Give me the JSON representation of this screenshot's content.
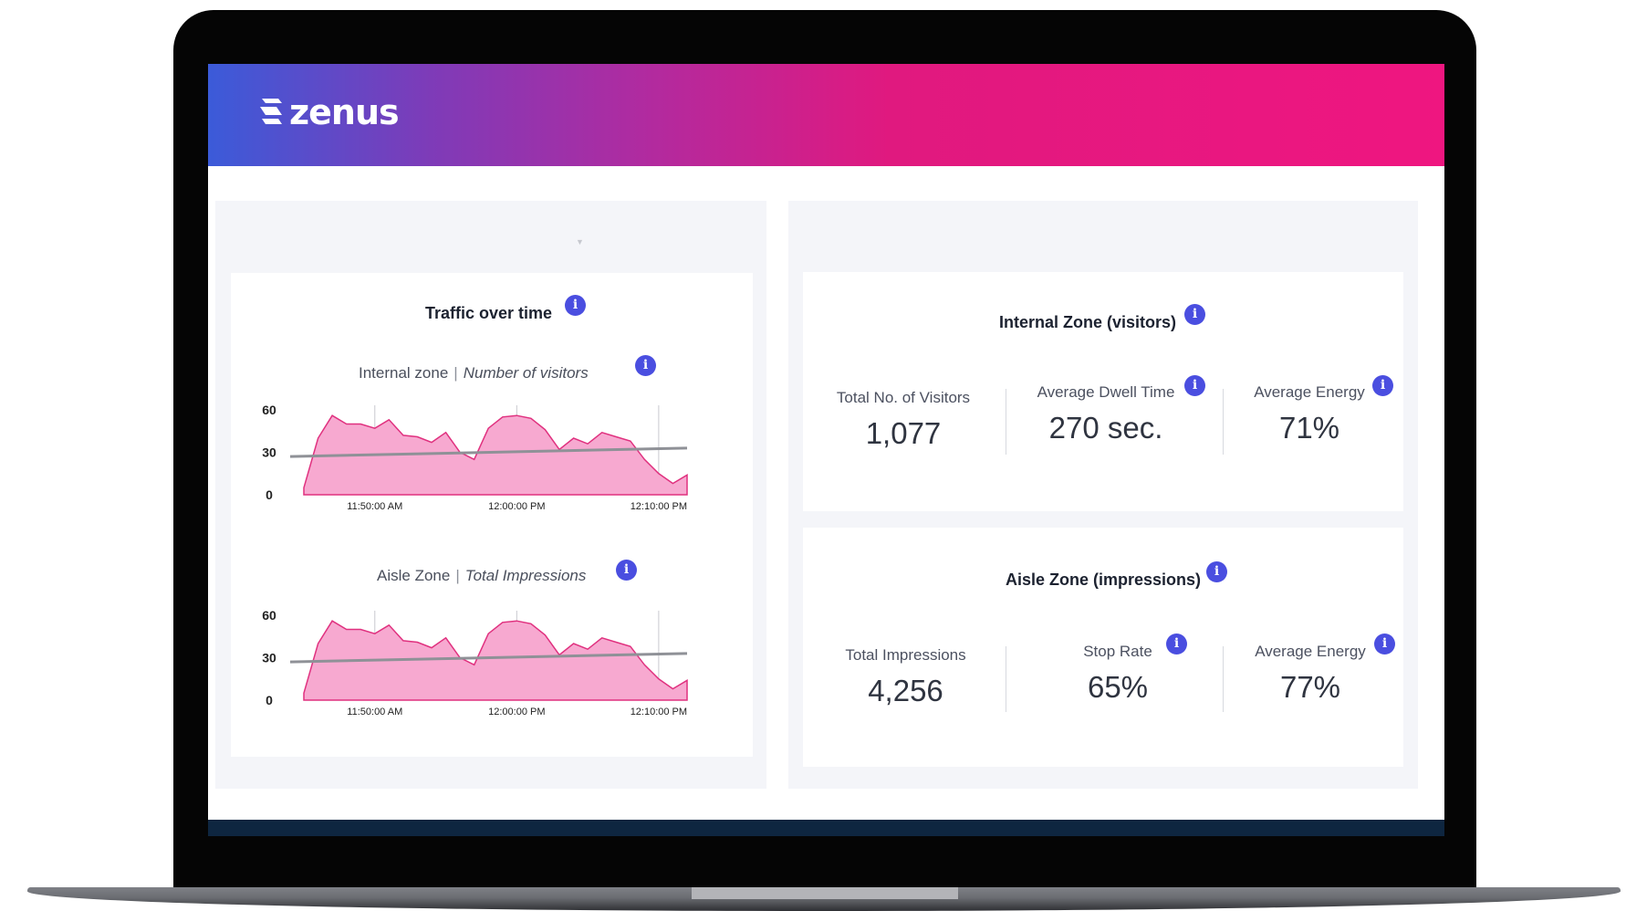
{
  "brand": {
    "name": "zenus"
  },
  "traffic_card": {
    "title": "Traffic over time",
    "charts": [
      {
        "zone": "Internal zone",
        "metric": "Number of visitors",
        "y_ticks": [
          "60",
          "30",
          "0"
        ],
        "x_ticks": [
          "11:50:00 AM",
          "12:00:00 PM",
          "12:10:00 PM"
        ]
      },
      {
        "zone": "Aisle Zone",
        "metric": "Total Impressions",
        "y_ticks": [
          "60",
          "30",
          "0"
        ],
        "x_ticks": [
          "11:50:00 AM",
          "12:00:00 PM",
          "12:10:00 PM"
        ]
      }
    ]
  },
  "internal_card": {
    "title": "Internal Zone (visitors)",
    "metrics": [
      {
        "label": "Total No. of Visitors",
        "value": "1,077"
      },
      {
        "label": "Average Dwell Time",
        "value": "270 sec."
      },
      {
        "label": "Average Energy",
        "value": "71%"
      }
    ]
  },
  "aisle_card": {
    "title": "Aisle Zone (impressions)",
    "metrics": [
      {
        "label": "Total Impressions",
        "value": "4,256"
      },
      {
        "label": "Stop Rate",
        "value": "65%"
      },
      {
        "label": "Average Energy",
        "value": "77%"
      }
    ]
  },
  "colors": {
    "area_fill": "#f7a9d0",
    "area_stroke": "#e0317f",
    "trend_line": "#8f9197",
    "info_icon": "#4a4ee0",
    "header_start": "#3b5bd9",
    "header_end": "#ef1680"
  },
  "chart_data": [
    {
      "type": "area",
      "x": [
        "11:45",
        "11:46",
        "11:47",
        "11:48",
        "11:49",
        "11:50",
        "11:51",
        "11:52",
        "11:53",
        "11:54",
        "11:55",
        "11:56",
        "11:57",
        "11:58",
        "11:59",
        "12:00",
        "12:01",
        "12:02",
        "12:03",
        "12:04",
        "12:05",
        "12:06",
        "12:07",
        "12:08",
        "12:09",
        "12:10",
        "12:11",
        "12:12"
      ],
      "xtick_labels": [
        "11:50:00 AM",
        "12:00:00 PM",
        "12:10:00 PM"
      ],
      "series": [
        {
          "values": [
            5,
            40,
            56,
            50,
            50,
            47,
            53,
            42,
            41,
            37,
            44,
            30,
            25,
            47,
            55,
            56,
            54,
            46,
            32,
            40,
            36,
            44,
            41,
            38,
            25,
            15,
            8,
            14
          ]
        }
      ],
      "trend": [
        27,
        33
      ],
      "ylim": [
        0,
        60
      ],
      "yticks": [
        0,
        30,
        60
      ]
    },
    {
      "type": "area",
      "x": [
        "11:45",
        "11:46",
        "11:47",
        "11:48",
        "11:49",
        "11:50",
        "11:51",
        "11:52",
        "11:53",
        "11:54",
        "11:55",
        "11:56",
        "11:57",
        "11:58",
        "11:59",
        "12:00",
        "12:01",
        "12:02",
        "12:03",
        "12:04",
        "12:05",
        "12:06",
        "12:07",
        "12:08",
        "12:09",
        "12:10",
        "12:11",
        "12:12"
      ],
      "xtick_labels": [
        "11:50:00 AM",
        "12:00:00 PM",
        "12:10:00 PM"
      ],
      "series": [
        {
          "values": [
            5,
            40,
            56,
            50,
            50,
            47,
            53,
            42,
            41,
            37,
            44,
            30,
            25,
            47,
            55,
            56,
            54,
            46,
            32,
            40,
            36,
            44,
            41,
            38,
            25,
            15,
            8,
            14
          ]
        }
      ],
      "trend": [
        27,
        33
      ],
      "ylim": [
        0,
        60
      ],
      "yticks": [
        0,
        30,
        60
      ]
    }
  ]
}
